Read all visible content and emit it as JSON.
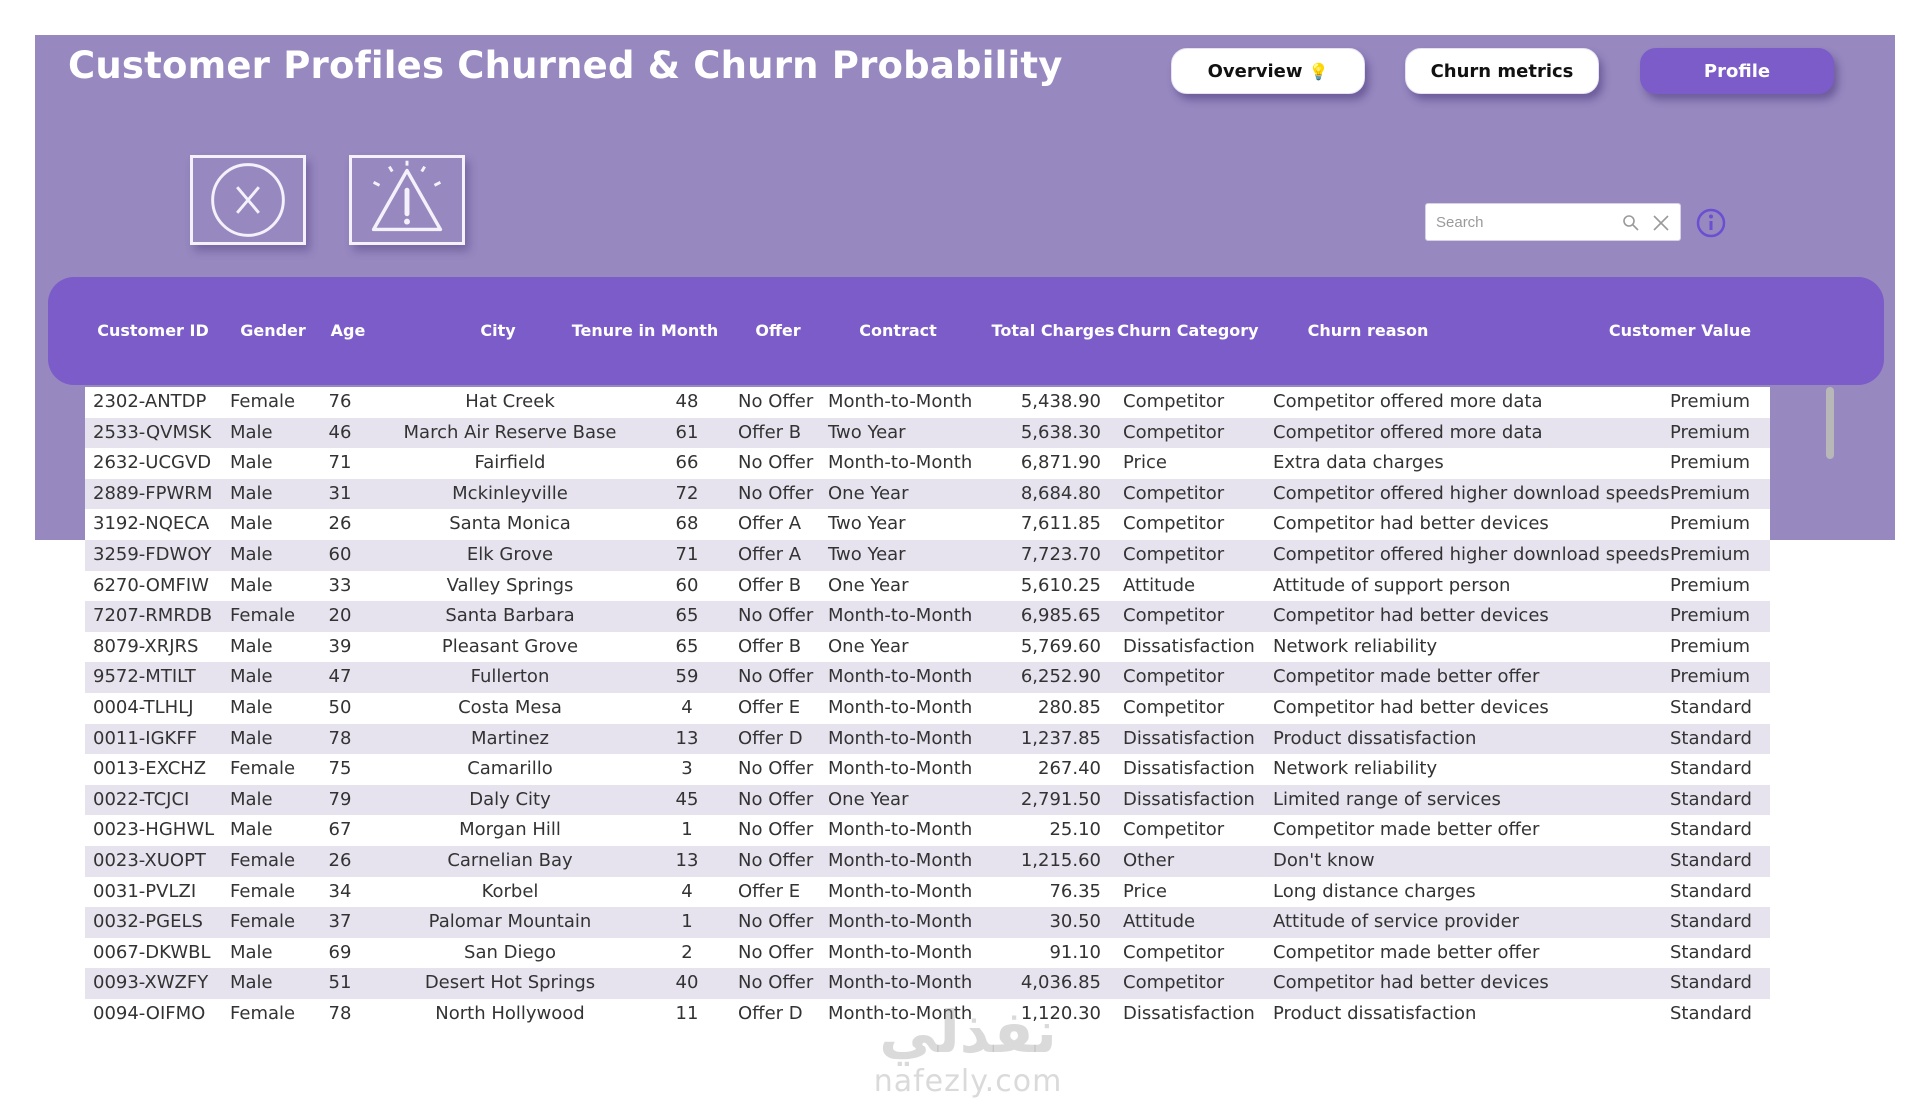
{
  "header": {
    "title": "Customer Profiles Churned & Churn Probability"
  },
  "nav": {
    "overview_label": "Overview",
    "churn_metrics_label": "Churn metrics",
    "profile_label": "Profile"
  },
  "filters": {
    "churned_icon": "x-circle-icon",
    "at_risk_icon": "warning-triangle-icon"
  },
  "search": {
    "placeholder": "Search",
    "value": ""
  },
  "table": {
    "columns": [
      "Customer ID",
      "Gender",
      "Age",
      "City",
      "Tenure in Month",
      "Offer",
      "Contract",
      "Total Charges",
      "Churn Category",
      "Churn reason",
      "Customer Value"
    ],
    "rows": [
      [
        "2302-ANTDP",
        "Female",
        "76",
        "Hat Creek",
        "48",
        "No Offer",
        "Month-to-Month",
        "5,438.90",
        "Competitor",
        "Competitor offered more data",
        "Premium"
      ],
      [
        "2533-QVMSK",
        "Male",
        "46",
        "March Air Reserve Base",
        "61",
        "Offer B",
        "Two Year",
        "5,638.30",
        "Competitor",
        "Competitor offered more data",
        "Premium"
      ],
      [
        "2632-UCGVD",
        "Male",
        "71",
        "Fairfield",
        "66",
        "No Offer",
        "Month-to-Month",
        "6,871.90",
        "Price",
        "Extra data charges",
        "Premium"
      ],
      [
        "2889-FPWRM",
        "Male",
        "31",
        "Mckinleyville",
        "72",
        "No Offer",
        "One Year",
        "8,684.80",
        "Competitor",
        "Competitor offered higher download speeds",
        "Premium"
      ],
      [
        "3192-NQECA",
        "Male",
        "26",
        "Santa Monica",
        "68",
        "Offer A",
        "Two Year",
        "7,611.85",
        "Competitor",
        "Competitor had better devices",
        "Premium"
      ],
      [
        "3259-FDWOY",
        "Male",
        "60",
        "Elk Grove",
        "71",
        "Offer A",
        "Two Year",
        "7,723.70",
        "Competitor",
        "Competitor offered higher download speeds",
        "Premium"
      ],
      [
        "6270-OMFIW",
        "Male",
        "33",
        "Valley Springs",
        "60",
        "Offer B",
        "One Year",
        "5,610.25",
        "Attitude",
        "Attitude of support person",
        "Premium"
      ],
      [
        "7207-RMRDB",
        "Female",
        "20",
        "Santa Barbara",
        "65",
        "No Offer",
        "Month-to-Month",
        "6,985.65",
        "Competitor",
        "Competitor had better devices",
        "Premium"
      ],
      [
        "8079-XRJRS",
        "Male",
        "39",
        "Pleasant Grove",
        "65",
        "Offer B",
        "One Year",
        "5,769.60",
        "Dissatisfaction",
        "Network reliability",
        "Premium"
      ],
      [
        "9572-MTILT",
        "Male",
        "47",
        "Fullerton",
        "59",
        "No Offer",
        "Month-to-Month",
        "6,252.90",
        "Competitor",
        "Competitor made better offer",
        "Premium"
      ],
      [
        "0004-TLHLJ",
        "Male",
        "50",
        "Costa Mesa",
        "4",
        "Offer E",
        "Month-to-Month",
        "280.85",
        "Competitor",
        "Competitor had better devices",
        "Standard"
      ],
      [
        "0011-IGKFF",
        "Male",
        "78",
        "Martinez",
        "13",
        "Offer D",
        "Month-to-Month",
        "1,237.85",
        "Dissatisfaction",
        "Product dissatisfaction",
        "Standard"
      ],
      [
        "0013-EXCHZ",
        "Female",
        "75",
        "Camarillo",
        "3",
        "No Offer",
        "Month-to-Month",
        "267.40",
        "Dissatisfaction",
        "Network reliability",
        "Standard"
      ],
      [
        "0022-TCJCI",
        "Male",
        "79",
        "Daly City",
        "45",
        "No Offer",
        "One Year",
        "2,791.50",
        "Dissatisfaction",
        "Limited range of services",
        "Standard"
      ],
      [
        "0023-HGHWL",
        "Male",
        "67",
        "Morgan Hill",
        "1",
        "No Offer",
        "Month-to-Month",
        "25.10",
        "Competitor",
        "Competitor made better offer",
        "Standard"
      ],
      [
        "0023-XUOPT",
        "Female",
        "26",
        "Carnelian Bay",
        "13",
        "No Offer",
        "Month-to-Month",
        "1,215.60",
        "Other",
        "Don't know",
        "Standard"
      ],
      [
        "0031-PVLZI",
        "Female",
        "34",
        "Korbel",
        "4",
        "Offer E",
        "Month-to-Month",
        "76.35",
        "Price",
        "Long distance charges",
        "Standard"
      ],
      [
        "0032-PGELS",
        "Female",
        "37",
        "Palomar Mountain",
        "1",
        "No Offer",
        "Month-to-Month",
        "30.50",
        "Attitude",
        "Attitude of service provider",
        "Standard"
      ],
      [
        "0067-DKWBL",
        "Male",
        "69",
        "San Diego",
        "2",
        "No Offer",
        "Month-to-Month",
        "91.10",
        "Competitor",
        "Competitor made better offer",
        "Standard"
      ],
      [
        "0093-XWZFY",
        "Male",
        "51",
        "Desert Hot Springs",
        "40",
        "No Offer",
        "Month-to-Month",
        "4,036.85",
        "Competitor",
        "Competitor had better devices",
        "Standard"
      ],
      [
        "0094-OIFMO",
        "Female",
        "78",
        "North Hollywood",
        "11",
        "Offer D",
        "Month-to-Month",
        "1,120.30",
        "Dissatisfaction",
        "Product dissatisfaction",
        "Standard"
      ]
    ]
  },
  "watermark": {
    "arabic": "نفذلي",
    "latin": "nafezly.com"
  },
  "colors": {
    "banner": "#9788c0",
    "accent": "#7b5cc9",
    "row_alt": "#e6e3ef"
  }
}
